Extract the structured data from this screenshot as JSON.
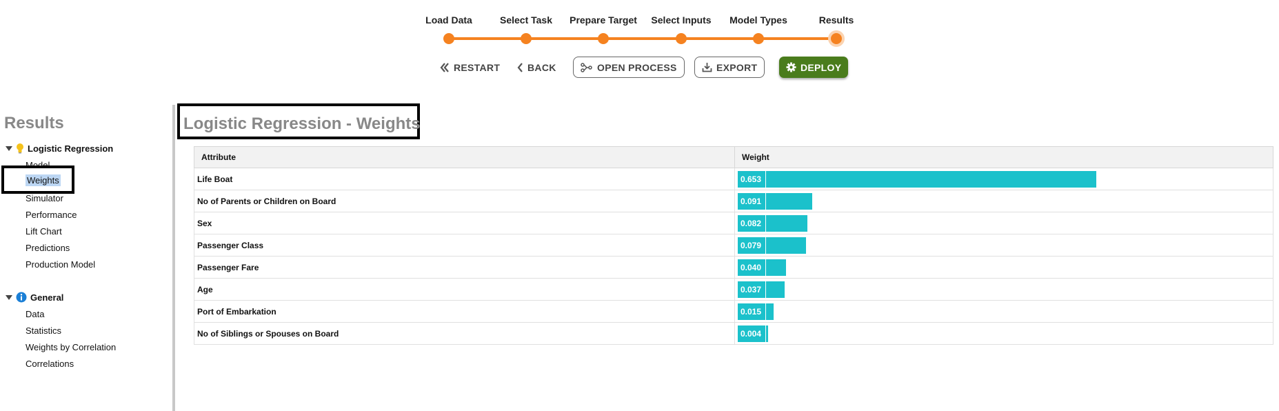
{
  "stepper": {
    "steps": [
      {
        "label": "Load Data"
      },
      {
        "label": "Select Task"
      },
      {
        "label": "Prepare Target"
      },
      {
        "label": "Select Inputs"
      },
      {
        "label": "Model Types"
      },
      {
        "label": "Results"
      }
    ],
    "current_step": "Results"
  },
  "actions": {
    "restart": "RESTART",
    "back": "BACK",
    "open_process": "OPEN PROCESS",
    "export": "EXPORT",
    "deploy": "DEPLOY"
  },
  "sidebar": {
    "title": "Results",
    "groups": [
      {
        "label": "Logistic Regression",
        "icon": "lightbulb-icon",
        "items": [
          "Model",
          "Weights",
          "Simulator",
          "Performance",
          "Lift Chart",
          "Predictions",
          "Production Model"
        ]
      },
      {
        "label": "General",
        "icon": "info-icon",
        "items": [
          "Data",
          "Statistics",
          "Weights by Correlation",
          "Correlations"
        ]
      }
    ],
    "selected_item": "Weights"
  },
  "main": {
    "title": "Logistic Regression - Weights",
    "table": {
      "headers": [
        "Attribute",
        "Weight"
      ],
      "rows": [
        {
          "attribute": "Life Boat",
          "weight": "0.653"
        },
        {
          "attribute": "No of Parents or Children on Board",
          "weight": "0.091"
        },
        {
          "attribute": "Sex",
          "weight": "0.082"
        },
        {
          "attribute": "Passenger Class",
          "weight": "0.079"
        },
        {
          "attribute": "Passenger Fare",
          "weight": "0.040"
        },
        {
          "attribute": "Age",
          "weight": "0.037"
        },
        {
          "attribute": "Port of Embarkation",
          "weight": "0.015"
        },
        {
          "attribute": "No of Siblings or Spouses on Board",
          "weight": "0.004"
        }
      ]
    }
  },
  "colors": {
    "accent_orange": "#f58220",
    "deploy_green": "#4a7c1c",
    "bar_teal": "#1bc1cb",
    "selection_blue": "#bcd6f3",
    "heading_gray": "#888888"
  }
}
